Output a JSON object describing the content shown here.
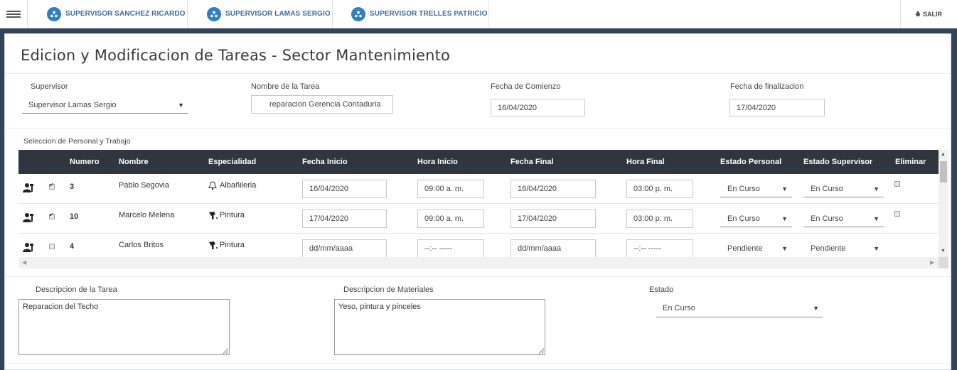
{
  "nav": {
    "tabs": [
      {
        "label": "SUPERVISOR SANCHEZ RICARDO"
      },
      {
        "label": "SUPERVISOR LAMAS SERGIO"
      },
      {
        "label": "SUPERVISOR TRELLES PATRICIO"
      }
    ],
    "logout": "SALIR"
  },
  "page": {
    "title": "Edicion y Modificacion de Tareas - Sector Mantenimiento"
  },
  "form": {
    "supervisor_label": "Supervisor",
    "supervisor_value": "Supervisor Lamas Sergio",
    "task_name_label": "Nombre de la Tarea",
    "task_name_value": "reparacion Gerencia Contaduria",
    "start_date_label": "Fecha de Comienzo",
    "start_date_value": "16/04/2020",
    "end_date_label": "Fecha de finalizacion",
    "end_date_value": "17/04/2020"
  },
  "staff": {
    "section_label": "Seleccion de Personal y Trabajo",
    "headers": {
      "numero": "Numero",
      "nombre": "Nombre",
      "especialidad": "Especialidad",
      "fecha_inicio": "Fecha Inicio",
      "hora_inicio": "Hora Inicio",
      "fecha_final": "Fecha Final",
      "hora_final": "Hora Final",
      "estado_personal": "Estado Personal",
      "estado_supervisor": "Estado Supervisor",
      "eliminar": "Eliminar"
    },
    "rows": [
      {
        "checked": true,
        "numero": "3",
        "nombre": "Pablo Segovia",
        "especialidad": "Albañileria",
        "fecha_inicio": "16/04/2020",
        "hora_inicio": "09:00 a. m.",
        "fecha_final": "16/04/2020",
        "hora_final": "03:00 p. m.",
        "estado_personal": "En Curso",
        "estado_supervisor": "En Curso"
      },
      {
        "checked": true,
        "numero": "10",
        "nombre": "Marcelo Melena",
        "especialidad": "Pintura",
        "fecha_inicio": "17/04/2020",
        "hora_inicio": "09:00 a. m.",
        "fecha_final": "17/04/2020",
        "hora_final": "03:00 p. m.",
        "estado_personal": "En Curso",
        "estado_supervisor": "En Curso"
      },
      {
        "checked": false,
        "numero": "4",
        "nombre": "Carlos Britos",
        "especialidad": "Pintura",
        "fecha_inicio": "dd/mm/aaaa",
        "hora_inicio": "--:-- -----",
        "fecha_final": "dd/mm/aaaa",
        "hora_final": "--:-- -----",
        "estado_personal": "Pendiente",
        "estado_supervisor": "Pendiente"
      }
    ]
  },
  "bottom": {
    "task_desc_label": "Descripcion de la Tarea",
    "task_desc_value": "Reparacion del Techo",
    "materials_label": "Descripcion de Materiales",
    "materials_value": "Yeso, pintura y pinceles",
    "status_label": "Estado",
    "status_value": "En Curso"
  }
}
